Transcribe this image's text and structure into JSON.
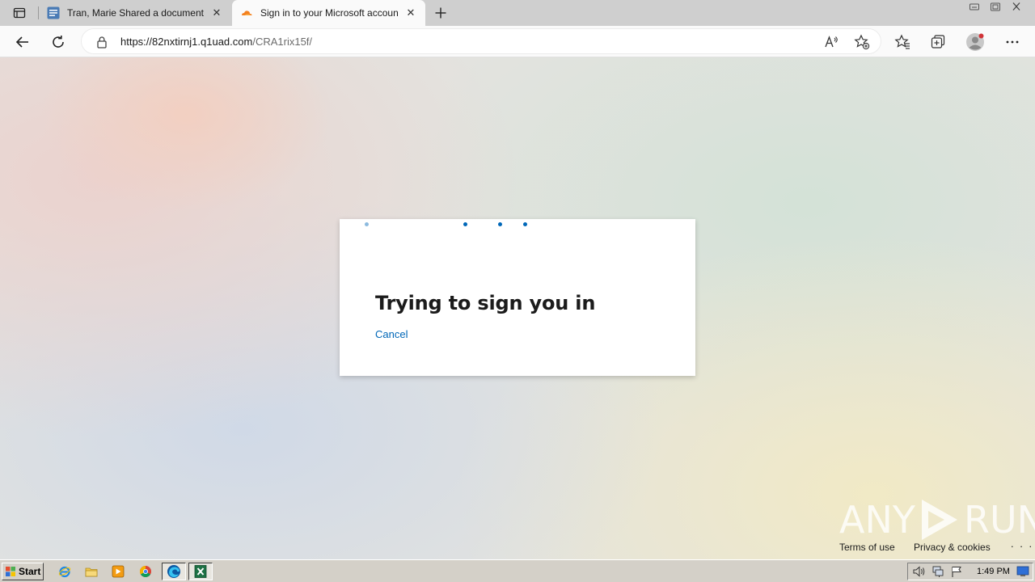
{
  "browser": {
    "tabs": [
      {
        "title": "Tran, Marie Shared a document w",
        "icon": "document-icon"
      },
      {
        "title": "Sign in to your Microsoft accoun",
        "icon": "cloudflare-icon"
      }
    ],
    "address": {
      "url_host": "https://82nxtirnj1.q1uad.com",
      "url_path": "/CRA1rix15f/",
      "read_aloud": "A)"
    }
  },
  "signin": {
    "heading": "Trying to sign you in",
    "cancel_label": "Cancel",
    "accent_color": "#0067b8"
  },
  "watermark": {
    "left": "ANY",
    "right": "RUN"
  },
  "footer": {
    "terms": "Terms of use",
    "privacy": "Privacy & cookies",
    "more": ". . ."
  },
  "taskbar": {
    "start_label": "Start",
    "clock": "1:49 PM"
  }
}
